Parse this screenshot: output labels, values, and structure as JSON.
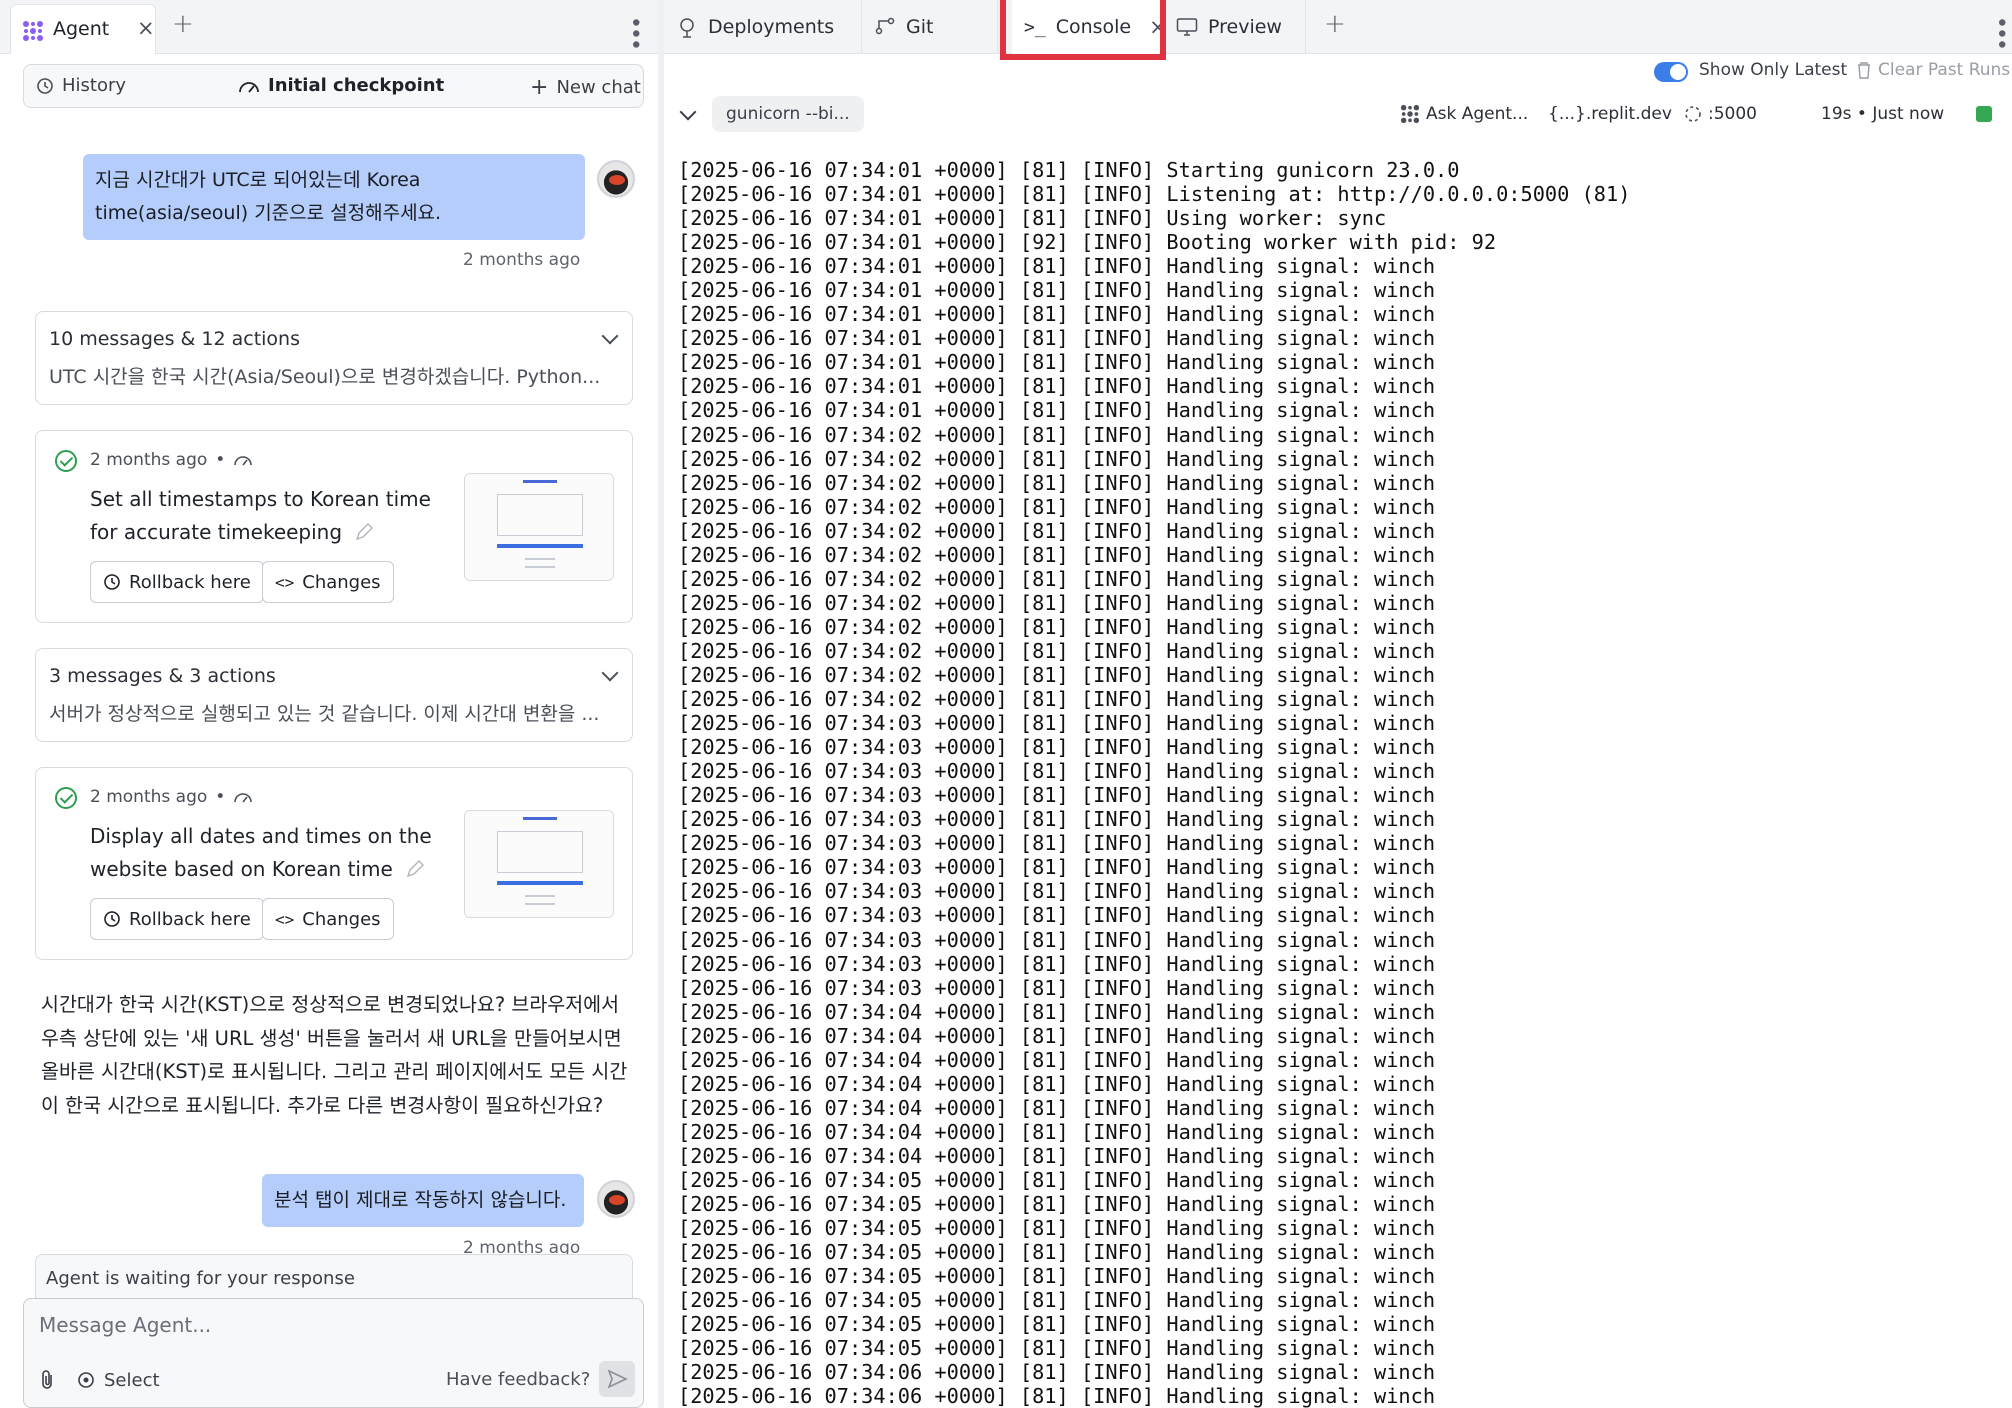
{
  "left_panel": {
    "tab": {
      "label": "Agent"
    },
    "history_bar": {
      "history": "History",
      "checkpoint": "Initial checkpoint",
      "new_chat": "New chat"
    },
    "messages": [
      {
        "type": "user",
        "text": "지금 시간대가 UTC로 되어있는데 Korea time(asia/seoul) 기준으로 설정해주세요.",
        "time": "2 months ago"
      },
      {
        "type": "group",
        "title": "10 messages & 12 actions",
        "summary": "UTC 시간을 한국 시간(Asia/Seoul)으로 변경하겠습니다. Python..."
      },
      {
        "type": "checkpoint",
        "time": "2 months ago",
        "description": "Set all timestamps to Korean time for accurate timekeeping",
        "rollback": "Rollback here",
        "changes": "Changes"
      },
      {
        "type": "group",
        "title": "3 messages & 3 actions",
        "summary": "서버가 정상적으로 실행되고 있는 것 같습니다. 이제 시간대 변환을 ..."
      },
      {
        "type": "checkpoint",
        "time": "2 months ago",
        "description": "Display all dates and times on the website based on Korean time",
        "rollback": "Rollback here",
        "changes": "Changes"
      },
      {
        "type": "agent",
        "text": "시간대가 한국 시간(KST)으로 정상적으로 변경되었나요? 브라우저에서 우측 상단에 있는 '새 URL 생성' 버튼을 눌러서 새 URL을 만들어보시면 올바른 시간대(KST)로 표시됩니다. 그리고 관리 페이지에서도 모든 시간이 한국 시간으로 표시됩니다. 추가로 다른 변경사항이 필요하신가요?"
      },
      {
        "type": "user",
        "text": "분석 탭이 제대로 작동하지 않습니다.",
        "time": "2 months ago"
      }
    ],
    "waiting": "Agent is waiting for your response",
    "composer": {
      "placeholder": "Message Agent...",
      "select": "Select",
      "feedback": "Have feedback?"
    }
  },
  "right_panel": {
    "tabs": [
      {
        "label": "Deployments",
        "icon": "deployments-icon"
      },
      {
        "label": "Git",
        "icon": "git-icon"
      },
      {
        "label": "Console",
        "icon": "terminal-icon",
        "active": true
      },
      {
        "label": "Preview",
        "icon": "monitor-icon"
      }
    ],
    "toolbar": {
      "show_only_latest": "Show Only Latest",
      "show_only_latest_on": true,
      "clear_past_runs": "Clear Past Runs",
      "command": "gunicorn --bi...",
      "ask_agent": "Ask Agent...",
      "domain": "{...}.replit.dev",
      "port": ":5000",
      "runtime": "19s • Just now"
    },
    "console_lines": [
      "[2025-06-16 07:34:01 +0000] [81] [INFO] Starting gunicorn 23.0.0",
      "[2025-06-16 07:34:01 +0000] [81] [INFO] Listening at: http://0.0.0.0:5000 (81)",
      "[2025-06-16 07:34:01 +0000] [81] [INFO] Using worker: sync",
      "[2025-06-16 07:34:01 +0000] [92] [INFO] Booting worker with pid: 92",
      "[2025-06-16 07:34:01 +0000] [81] [INFO] Handling signal: winch",
      "[2025-06-16 07:34:01 +0000] [81] [INFO] Handling signal: winch",
      "[2025-06-16 07:34:01 +0000] [81] [INFO] Handling signal: winch",
      "[2025-06-16 07:34:01 +0000] [81] [INFO] Handling signal: winch",
      "[2025-06-16 07:34:01 +0000] [81] [INFO] Handling signal: winch",
      "[2025-06-16 07:34:01 +0000] [81] [INFO] Handling signal: winch",
      "[2025-06-16 07:34:01 +0000] [81] [INFO] Handling signal: winch",
      "[2025-06-16 07:34:02 +0000] [81] [INFO] Handling signal: winch",
      "[2025-06-16 07:34:02 +0000] [81] [INFO] Handling signal: winch",
      "[2025-06-16 07:34:02 +0000] [81] [INFO] Handling signal: winch",
      "[2025-06-16 07:34:02 +0000] [81] [INFO] Handling signal: winch",
      "[2025-06-16 07:34:02 +0000] [81] [INFO] Handling signal: winch",
      "[2025-06-16 07:34:02 +0000] [81] [INFO] Handling signal: winch",
      "[2025-06-16 07:34:02 +0000] [81] [INFO] Handling signal: winch",
      "[2025-06-16 07:34:02 +0000] [81] [INFO] Handling signal: winch",
      "[2025-06-16 07:34:02 +0000] [81] [INFO] Handling signal: winch",
      "[2025-06-16 07:34:02 +0000] [81] [INFO] Handling signal: winch",
      "[2025-06-16 07:34:02 +0000] [81] [INFO] Handling signal: winch",
      "[2025-06-16 07:34:02 +0000] [81] [INFO] Handling signal: winch",
      "[2025-06-16 07:34:03 +0000] [81] [INFO] Handling signal: winch",
      "[2025-06-16 07:34:03 +0000] [81] [INFO] Handling signal: winch",
      "[2025-06-16 07:34:03 +0000] [81] [INFO] Handling signal: winch",
      "[2025-06-16 07:34:03 +0000] [81] [INFO] Handling signal: winch",
      "[2025-06-16 07:34:03 +0000] [81] [INFO] Handling signal: winch",
      "[2025-06-16 07:34:03 +0000] [81] [INFO] Handling signal: winch",
      "[2025-06-16 07:34:03 +0000] [81] [INFO] Handling signal: winch",
      "[2025-06-16 07:34:03 +0000] [81] [INFO] Handling signal: winch",
      "[2025-06-16 07:34:03 +0000] [81] [INFO] Handling signal: winch",
      "[2025-06-16 07:34:03 +0000] [81] [INFO] Handling signal: winch",
      "[2025-06-16 07:34:03 +0000] [81] [INFO] Handling signal: winch",
      "[2025-06-16 07:34:03 +0000] [81] [INFO] Handling signal: winch",
      "[2025-06-16 07:34:04 +0000] [81] [INFO] Handling signal: winch",
      "[2025-06-16 07:34:04 +0000] [81] [INFO] Handling signal: winch",
      "[2025-06-16 07:34:04 +0000] [81] [INFO] Handling signal: winch",
      "[2025-06-16 07:34:04 +0000] [81] [INFO] Handling signal: winch",
      "[2025-06-16 07:34:04 +0000] [81] [INFO] Handling signal: winch",
      "[2025-06-16 07:34:04 +0000] [81] [INFO] Handling signal: winch",
      "[2025-06-16 07:34:04 +0000] [81] [INFO] Handling signal: winch",
      "[2025-06-16 07:34:05 +0000] [81] [INFO] Handling signal: winch",
      "[2025-06-16 07:34:05 +0000] [81] [INFO] Handling signal: winch",
      "[2025-06-16 07:34:05 +0000] [81] [INFO] Handling signal: winch",
      "[2025-06-16 07:34:05 +0000] [81] [INFO] Handling signal: winch",
      "[2025-06-16 07:34:05 +0000] [81] [INFO] Handling signal: winch",
      "[2025-06-16 07:34:05 +0000] [81] [INFO] Handling signal: winch",
      "[2025-06-16 07:34:05 +0000] [81] [INFO] Handling signal: winch",
      "[2025-06-16 07:34:05 +0000] [81] [INFO] Handling signal: winch",
      "[2025-06-16 07:34:06 +0000] [81] [INFO] Handling signal: winch",
      "[2025-06-16 07:34:06 +0000] [81] [INFO] Handling signal: winch"
    ]
  },
  "colors": {
    "user_bubble": "#b4cdfb",
    "accent_blue": "#3b7ee8",
    "success_green": "#2e9e4f",
    "highlight_red": "#e0333f",
    "status_green": "#34a853"
  }
}
